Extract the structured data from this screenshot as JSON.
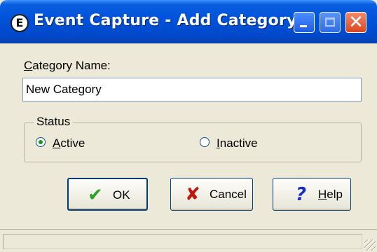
{
  "window": {
    "title": "Event Capture - Add Category",
    "app_icon_glyph": "E",
    "controls": {
      "minimize": "minimize-icon",
      "maximize": "maximize-icon",
      "close": "close-icon"
    }
  },
  "form": {
    "name_label": "Category Name:",
    "name_value": "New Category"
  },
  "status_group": {
    "legend": "Status",
    "options": [
      {
        "label": "Active",
        "selected": true
      },
      {
        "label": "Inactive",
        "selected": false
      }
    ]
  },
  "buttons": {
    "ok": {
      "label": "OK",
      "icon": "checkmark-icon",
      "color": "#2ba12b"
    },
    "cancel": {
      "label": "Cancel",
      "icon": "x-mark-icon",
      "color": "#c0140f"
    },
    "help": {
      "label": "Help",
      "icon": "question-mark-icon",
      "color": "#1a2fc7"
    }
  },
  "status_bar": {
    "text": ""
  }
}
